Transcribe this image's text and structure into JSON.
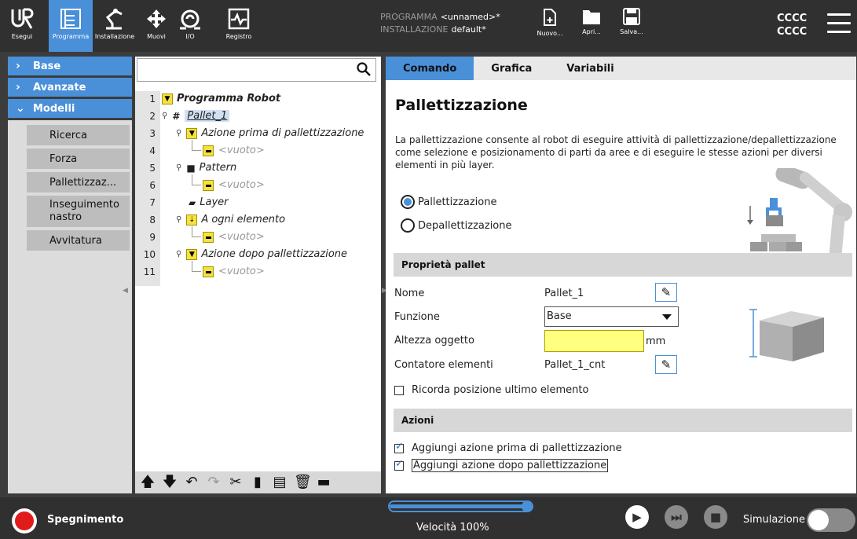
{
  "topbar": {
    "tabs": [
      {
        "label": "Esegui",
        "icon": "ur-logo-icon"
      },
      {
        "label": "Programma",
        "icon": "program-tree-icon",
        "active": true
      },
      {
        "label": "Installazione",
        "icon": "robot-arm-icon"
      },
      {
        "label": "Muovi",
        "icon": "move-arrows-icon"
      },
      {
        "label": "I/O",
        "icon": "io-icon"
      },
      {
        "label": "Registro",
        "icon": "log-icon"
      }
    ],
    "program_key": "PROGRAMMA",
    "program_value": "<unnamed>*",
    "installation_key": "INSTALLAZIONE",
    "installation_value": "default*",
    "file_buttons": [
      {
        "label": "Nuovo...",
        "icon": "new-file-icon"
      },
      {
        "label": "Apri...",
        "icon": "folder-icon"
      },
      {
        "label": "Salva...",
        "icon": "save-icon"
      }
    ],
    "user_line1": "CCCC",
    "user_line2": "CCCC",
    "accent_color": "#4a90d9"
  },
  "leftnav": {
    "sections": [
      {
        "label": "Base",
        "expanded": false
      },
      {
        "label": "Avanzate",
        "expanded": false
      },
      {
        "label": "Modelli",
        "expanded": true
      }
    ],
    "items": [
      {
        "label": "Ricerca"
      },
      {
        "label": "Forza"
      },
      {
        "label": "Pallettizzaz..."
      },
      {
        "label": "Inseguimento nastro"
      },
      {
        "label": "Avvitatura"
      }
    ]
  },
  "tree": {
    "search_placeholder": "",
    "rows": [
      {
        "num": "1",
        "label": "Programma Robot"
      },
      {
        "num": "2",
        "label": "Pallet_1"
      },
      {
        "num": "3",
        "label": "Azione prima di pallettizzazione"
      },
      {
        "num": "4",
        "label": "<vuoto>"
      },
      {
        "num": "5",
        "label": "Pattern"
      },
      {
        "num": "6",
        "label": "<vuoto>"
      },
      {
        "num": "7",
        "label": "Layer"
      },
      {
        "num": "8",
        "label": "A ogni elemento"
      },
      {
        "num": "9",
        "label": "<vuoto>"
      },
      {
        "num": "10",
        "label": "Azione dopo pallettizzazione"
      },
      {
        "num": "11",
        "label": "<vuoto>"
      }
    ]
  },
  "rightpane": {
    "tabs": [
      {
        "label": "Comando",
        "active": true
      },
      {
        "label": "Grafica"
      },
      {
        "label": "Variabili"
      }
    ],
    "title": "Pallettizzazione",
    "description": "La pallettizzazione consente al robot di eseguire attività di pallettizzazione/depallettizzazione come selezione e posizionamento di parti da aree e di eseguire le stesse azioni per diversi elementi in più layer.",
    "radio_options": [
      {
        "label": "Pallettizzazione",
        "selected": true
      },
      {
        "label": "Depallettizzazione",
        "selected": false
      }
    ],
    "props_header": "Proprietà pallet",
    "name_label": "Nome",
    "name_value": "Pallet_1",
    "function_label": "Funzione",
    "function_value": "Base",
    "height_label": "Altezza oggetto",
    "height_value": "",
    "height_unit": "mm",
    "counter_label": "Contatore elementi",
    "counter_value": "Pallet_1_cnt",
    "remember_label": "Ricorda posizione ultimo elemento",
    "remember_checked": false,
    "actions_header": "Azioni",
    "action_before_label": "Aggiungi azione prima di pallettizzazione",
    "action_before_checked": true,
    "action_after_label": "Aggiungi azione dopo pallettizzazione",
    "action_after_checked": true
  },
  "bottombar": {
    "power_label": "Spegnimento",
    "speed_label": "Velocità 100%",
    "speed_fraction": 1.0,
    "simulation_label": "Simulazione",
    "simulation_on": false
  }
}
